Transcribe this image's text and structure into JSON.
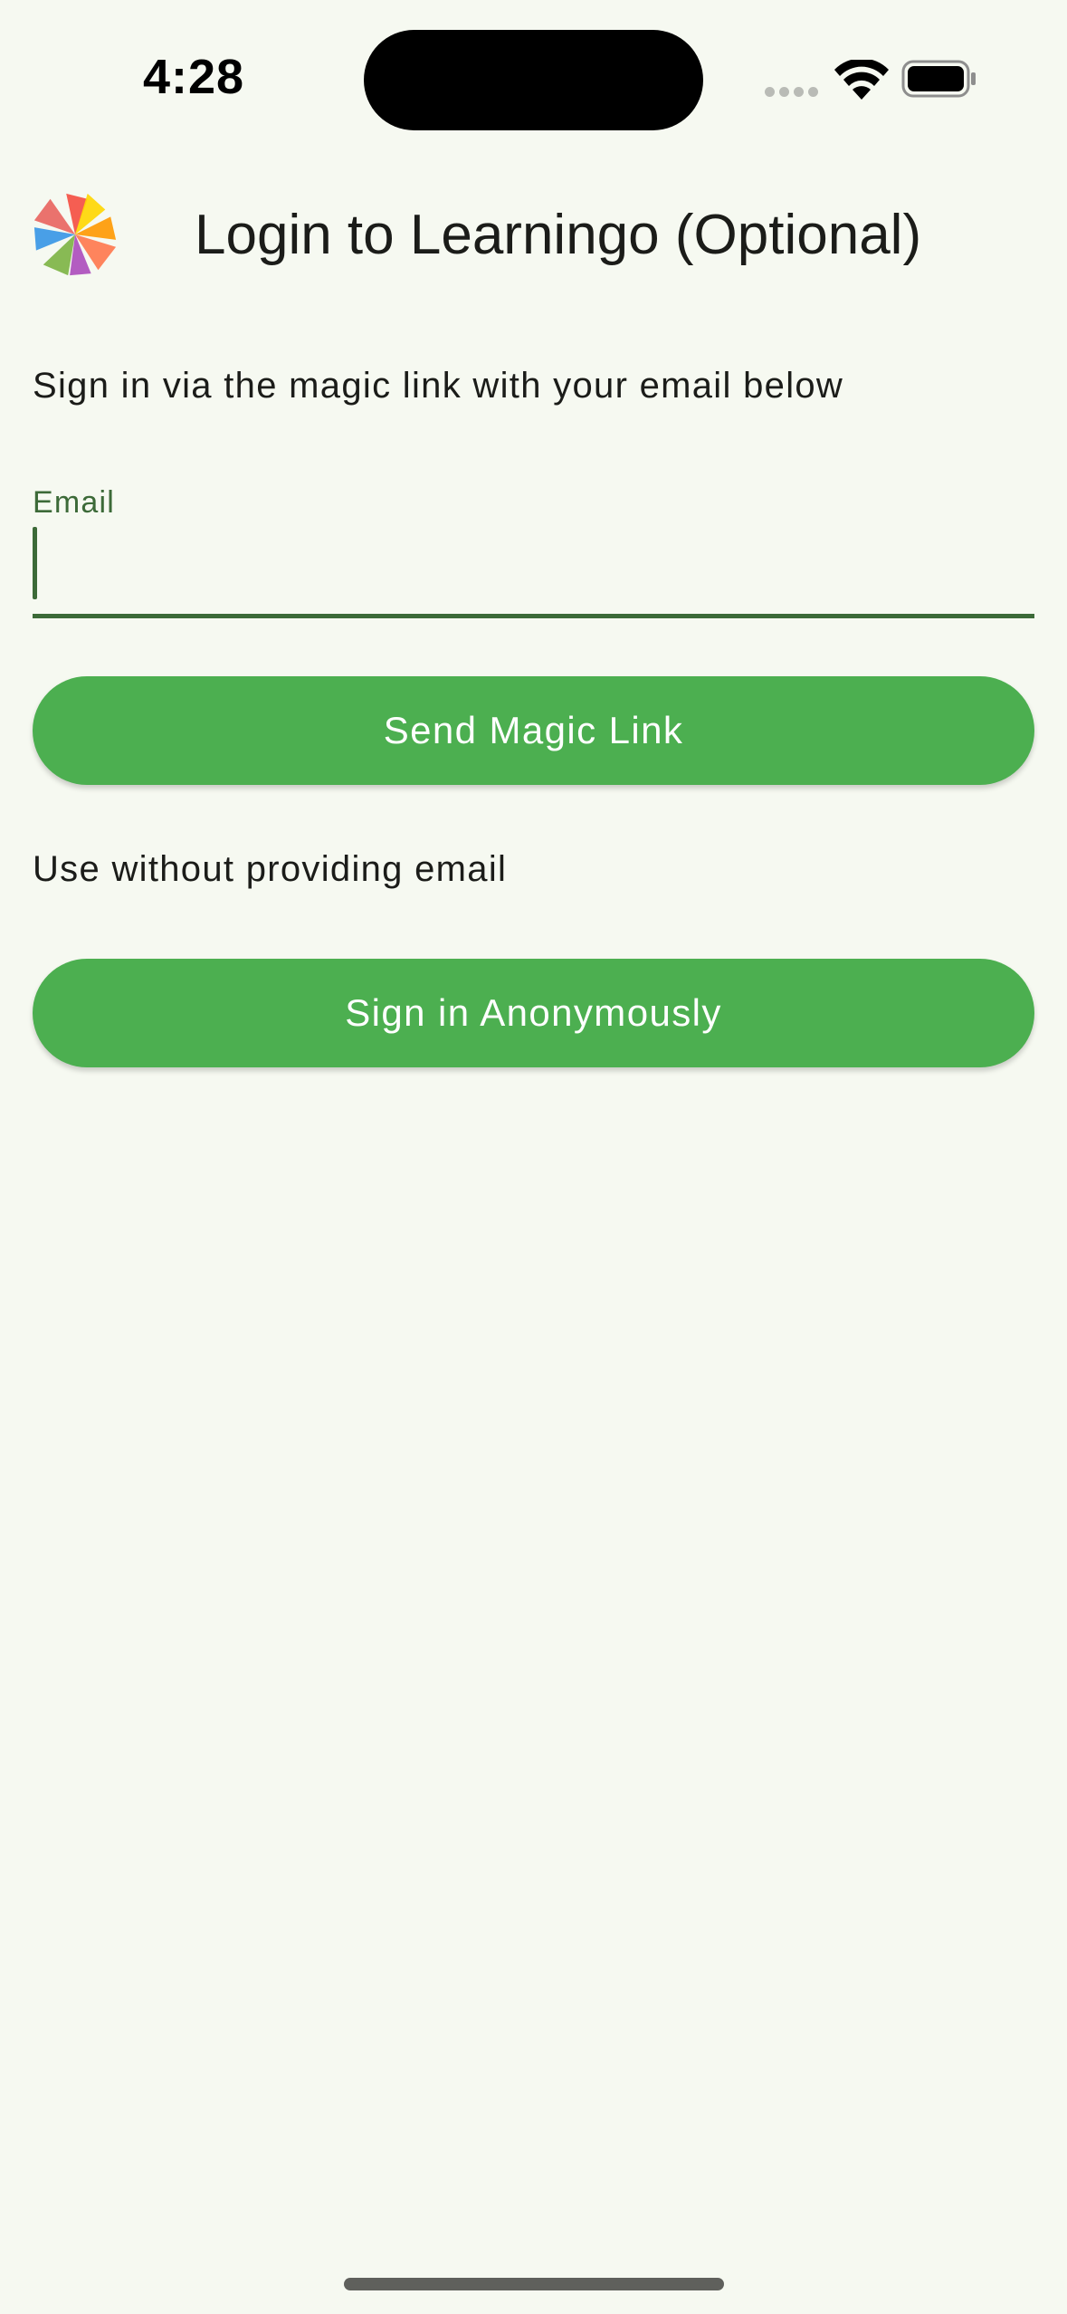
{
  "status_bar": {
    "time": "4:28",
    "icons": [
      "cellular-signal-icon",
      "wifi-icon",
      "battery-icon"
    ]
  },
  "header": {
    "logo_icon": "pinwheel-logo-icon",
    "title": "Login to Learningo (Optional)"
  },
  "magic_link": {
    "instructions": "Sign in via the magic link with your email below",
    "email_label": "Email",
    "email_value": "",
    "button_label": "Send Magic Link"
  },
  "anonymous": {
    "caption": "Use without providing email",
    "button_label": "Sign in Anonymously"
  },
  "colors": {
    "background": "#f6f9f1",
    "primary_button": "#4caf50",
    "field_accent": "#3c6a38",
    "text": "#1b1c19"
  }
}
